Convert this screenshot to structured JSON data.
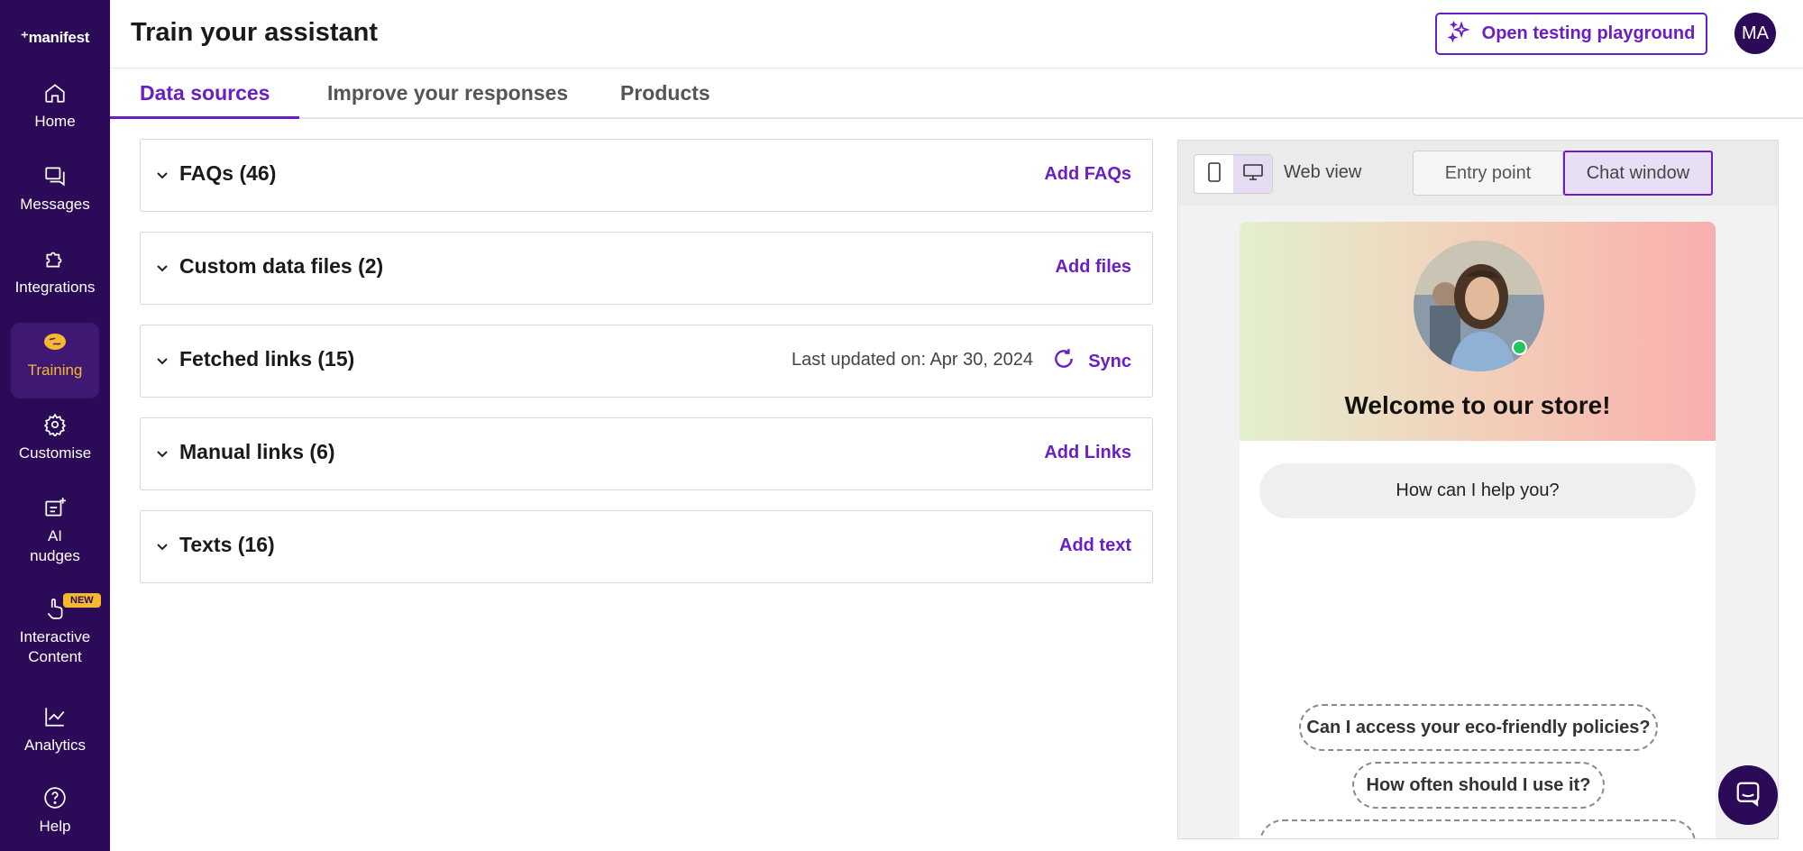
{
  "app": {
    "logo": "⁺manifest"
  },
  "sidebar": {
    "items": [
      {
        "label": "Home",
        "icon": "home-icon"
      },
      {
        "label": "Messages",
        "icon": "messages-icon"
      },
      {
        "label": "Integrations",
        "icon": "puzzle-icon"
      },
      {
        "label": "Training",
        "icon": "brain-icon",
        "active": true
      },
      {
        "label": "Customise",
        "icon": "gear-icon"
      },
      {
        "label": "AI nudges",
        "icon": "nudge-icon"
      },
      {
        "label": "Interactive Content",
        "icon": "pointer-hand-icon",
        "badge": "NEW"
      },
      {
        "label": "Analytics",
        "icon": "chart-line-icon"
      },
      {
        "label": "Help",
        "icon": "help-circle-icon"
      }
    ]
  },
  "header": {
    "title": "Train your assistant",
    "playground_button": "Open testing playground",
    "avatar_initials": "MA"
  },
  "tabs": [
    {
      "label": "Data sources",
      "active": true
    },
    {
      "label": "Improve your responses"
    },
    {
      "label": "Products"
    }
  ],
  "sections": [
    {
      "title": "FAQs (46)",
      "action": "Add FAQs"
    },
    {
      "title": "Custom data files (2)",
      "action": "Add files"
    },
    {
      "title": "Fetched links (15)",
      "meta": "Last updated on: Apr 30, 2024",
      "action": "Sync"
    },
    {
      "title": "Manual links (6)",
      "action": "Add Links"
    },
    {
      "title": "Texts (16)",
      "action": "Add text"
    }
  ],
  "preview": {
    "view_label": "Web view",
    "entry_point": "Entry point",
    "chat_window": "Chat window",
    "welcome": "Welcome to our store!",
    "greeting": "How can I help you?",
    "suggestions": [
      "Can I access your eco-friendly policies?",
      "How often should I use it?"
    ]
  },
  "colors": {
    "sidebar_bg": "#2b0a57",
    "accent": "#6a1fc4",
    "active_nav": "#f5b82e",
    "online": "#22c55e"
  }
}
